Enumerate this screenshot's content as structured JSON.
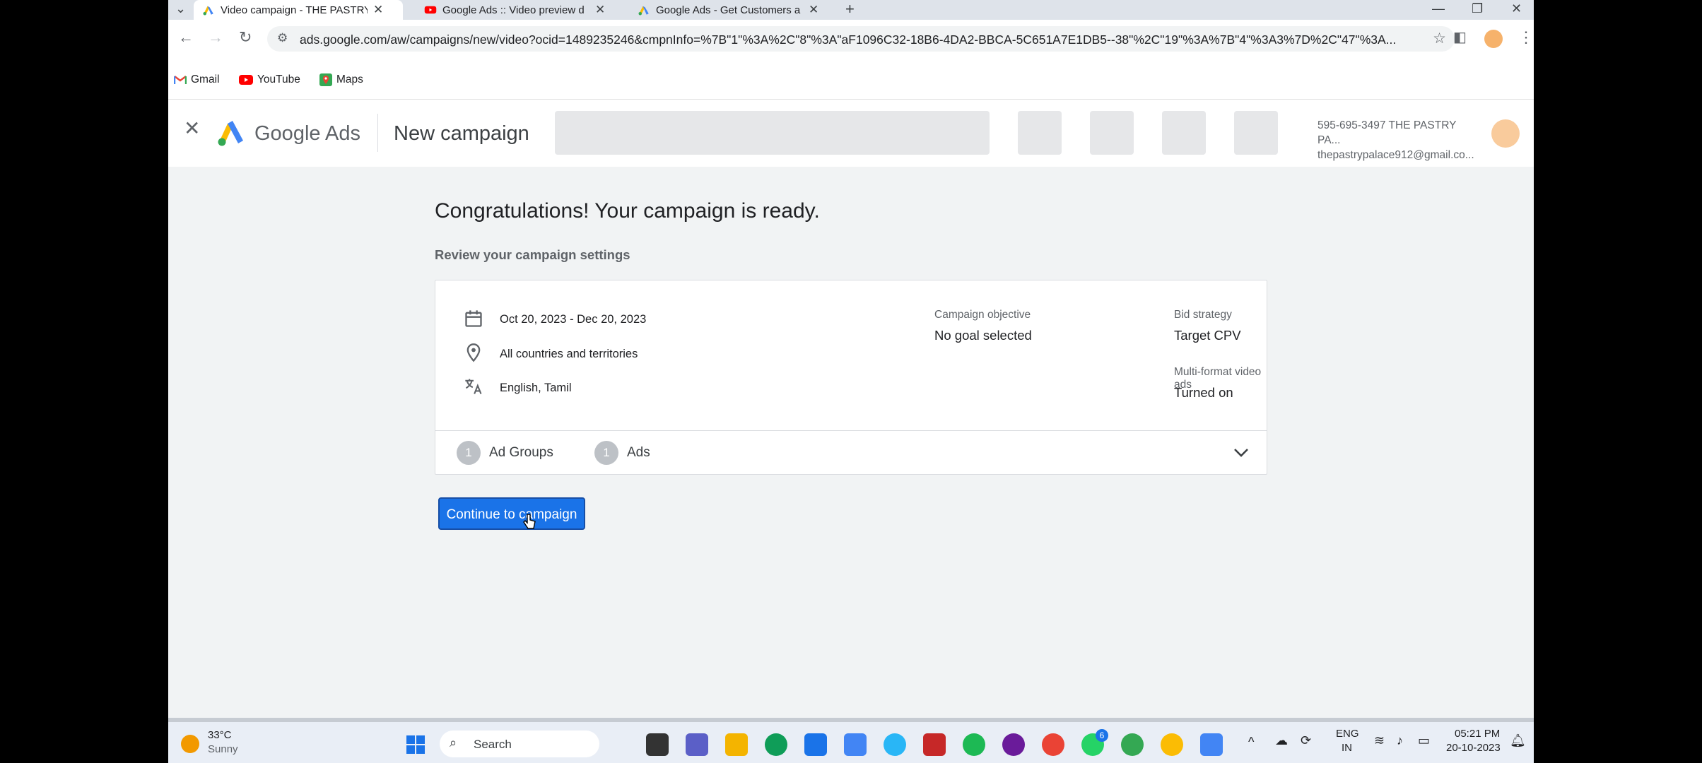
{
  "browser": {
    "tabs": [
      {
        "label": "Video campaign - THE PASTRY",
        "active": true
      },
      {
        "label": "Google Ads :: Video preview d",
        "active": false
      },
      {
        "label": "Google Ads - Get Customers a",
        "active": false
      }
    ],
    "url": "ads.google.com/aw/campaigns/new/video?ocid=1489235246&cmpnInfo=%7B\"1\"%3A%2C\"8\"%3A\"aF1096C32-18B6-4DA2-BBCA-5C651A7E1DB5--38\"%2C\"19\"%3A%7B\"4\"%3A3%7D%2C\"47\"%3A...",
    "bookmarks": [
      "Gmail",
      "YouTube",
      "Maps"
    ]
  },
  "appbar": {
    "product": "Google Ads",
    "page_title": "New campaign",
    "account_line1": "595-695-3497 THE PASTRY PA...",
    "account_line2": "thepastrypalace912@gmail.co..."
  },
  "main": {
    "heading": "Congratulations! Your campaign is ready.",
    "subheading": "Review your campaign settings",
    "dates": "Oct 20, 2023 - Dec 20, 2023",
    "location": "All countries and territories",
    "languages": "English, Tamil",
    "objective_label": "Campaign objective",
    "objective_value": "No goal selected",
    "bid_label": "Bid strategy",
    "bid_value": "Target CPV",
    "multiformat_label": "Multi-format video ads",
    "multiformat_value": "Turned on",
    "ad_groups_count": "1",
    "ad_groups_label": "Ad Groups",
    "ads_count": "1",
    "ads_label": "Ads",
    "continue_label": "Continue to campaign"
  },
  "taskbar": {
    "temp": "33°C",
    "weather": "Sunny",
    "search": "Search",
    "lang1": "ENG",
    "lang2": "IN",
    "time": "05:21 PM",
    "date": "20-10-2023",
    "whatsapp_badge": "6"
  },
  "colors": {
    "accent": "#1a73e8",
    "background": "#f1f3f4"
  }
}
